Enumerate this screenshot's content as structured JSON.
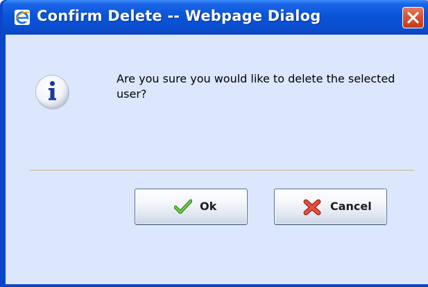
{
  "window": {
    "title": "Confirm Delete -- Webpage Dialog",
    "title_icon": "ie-icon",
    "close_icon": "close-icon"
  },
  "dialog": {
    "icon": "info-icon",
    "message": "Are you sure you would like to delete the selected user?"
  },
  "buttons": {
    "ok_label": "Ok",
    "ok_icon": "checkmark-icon",
    "cancel_label": "Cancel",
    "cancel_icon": "x-icon"
  },
  "colors": {
    "titlebar": "#0a54d8",
    "client_background": "#dce6fc",
    "close_button": "#d75334",
    "divider": "#c6b98a"
  }
}
